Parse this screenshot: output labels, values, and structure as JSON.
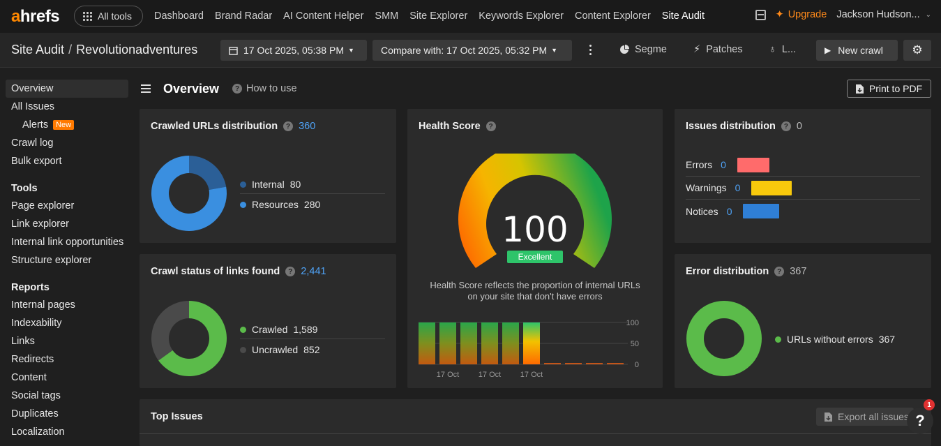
{
  "nav": {
    "logo_a": "a",
    "logo_rest": "hrefs",
    "all_tools": "All tools",
    "links": [
      "Dashboard",
      "Brand Radar",
      "AI Content Helper",
      "SMM",
      "Site Explorer",
      "Keywords Explorer",
      "Content Explorer",
      "Site Audit"
    ],
    "upgrade": "Upgrade",
    "user": "Jackson Hudson..."
  },
  "subheader": {
    "breadcrumb_root": "Site Audit",
    "breadcrumb_sep": "/",
    "project": "Revolutionadventures",
    "date": "17 Oct 2025, 05:38 PM",
    "compare": "Compare with: 17 Oct 2025, 05:32 PM",
    "segments": "Segme",
    "patches": "Patches",
    "third_tool": "L...",
    "new_crawl": "New crawl"
  },
  "sidebar": {
    "items_top": [
      "Overview",
      "All Issues",
      "Alerts",
      "Crawl log",
      "Bulk export"
    ],
    "new_badge": "New",
    "tools_head": "Tools",
    "tools": [
      "Page explorer",
      "Link explorer",
      "Internal link opportunities",
      "Structure explorer"
    ],
    "reports_head": "Reports",
    "reports": [
      "Internal pages",
      "Indexability",
      "Links",
      "Redirects",
      "Content",
      "Social tags",
      "Duplicates",
      "Localization"
    ]
  },
  "main": {
    "title": "Overview",
    "how_to": "How to use",
    "print_pdf": "Print to PDF"
  },
  "crawled_urls": {
    "title": "Crawled URLs distribution",
    "total": "360",
    "legend": [
      {
        "label": "Internal",
        "value": "80",
        "color": "#2b5f97"
      },
      {
        "label": "Resources",
        "value": "280",
        "color": "#3a8fe0"
      }
    ]
  },
  "crawl_status": {
    "title": "Crawl status of links found",
    "total": "2,441",
    "legend": [
      {
        "label": "Crawled",
        "value": "1,589",
        "color": "#5bbb4a"
      },
      {
        "label": "Uncrawled",
        "value": "852",
        "color": "#4a4a4a"
      }
    ]
  },
  "health_score": {
    "title": "Health Score",
    "score": "100",
    "rating": "Excellent",
    "caption_1": "Health Score reflects the proportion of internal URLs",
    "caption_2": "on your site that don't have errors",
    "axis_ticks": [
      "100",
      "50",
      "0"
    ],
    "x_labels": [
      "17 Oct",
      "17 Oct",
      "17 Oct"
    ]
  },
  "issues_distribution": {
    "title": "Issues distribution",
    "total": "0",
    "rows": [
      {
        "label": "Errors",
        "value": "0",
        "color": "#ff6b6b"
      },
      {
        "label": "Warnings",
        "value": "0",
        "color": "#f8c90c"
      },
      {
        "label": "Notices",
        "value": "0",
        "color": "#2f7fd6"
      }
    ]
  },
  "error_distribution": {
    "title": "Error distribution",
    "total": "367",
    "legend": [
      {
        "label": "URLs without errors",
        "value": "367",
        "color": "#5bbb4a"
      }
    ]
  },
  "top_issues": {
    "title": "Top Issues",
    "export": "Export all issues"
  },
  "help": {
    "badge": "1",
    "label": "?"
  },
  "chart_data": [
    {
      "type": "pie",
      "title": "Crawled URLs distribution",
      "categories": [
        "Internal",
        "Resources"
      ],
      "values": [
        80,
        280
      ]
    },
    {
      "type": "pie",
      "title": "Crawl status of links found",
      "categories": [
        "Crawled",
        "Uncrawled"
      ],
      "values": [
        1589,
        852
      ]
    },
    {
      "type": "bar",
      "title": "Health Score",
      "categories": [
        "17 Oct",
        "17 Oct",
        "17 Oct",
        "17 Oct",
        "17 Oct",
        "17 Oct",
        "",
        "",
        "",
        ""
      ],
      "values": [
        100,
        100,
        100,
        100,
        100,
        100,
        0,
        0,
        0,
        0
      ],
      "ylim": [
        0,
        100
      ]
    },
    {
      "type": "pie",
      "title": "Error distribution",
      "categories": [
        "URLs without errors"
      ],
      "values": [
        367
      ]
    }
  ]
}
